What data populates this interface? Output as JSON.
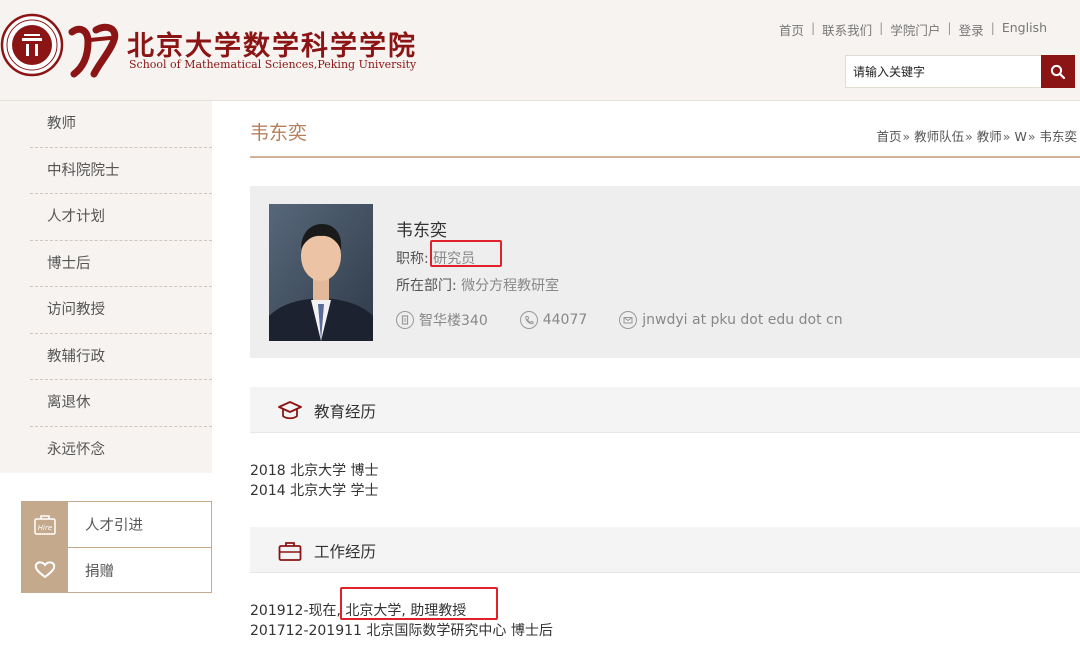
{
  "header": {
    "seal_text": "PEKING UNIVERSITY 1898",
    "brand_cn": "北京大学数学科学学院",
    "brand_en": "School of Mathematical Sciences,Peking University",
    "nav": [
      "首页",
      "联系我们",
      "学院门户",
      "登录",
      "English"
    ],
    "nav_separator": "|",
    "search_placeholder": "请输入关键字",
    "search_icon": "search-icon"
  },
  "sidebar": {
    "items": [
      "教师",
      "中科院院士",
      "人才计划",
      "博士后",
      "访问教授",
      "教辅行政",
      "离退休",
      "永远怀念"
    ],
    "quick_links": [
      {
        "label": "人才引进",
        "icon": "hire-icon",
        "icon_text": "Hire"
      },
      {
        "label": "捐赠",
        "icon": "heart-icon"
      }
    ]
  },
  "page": {
    "title": "韦东奕",
    "breadcrumb": [
      "首页",
      "教师队伍",
      "教师",
      "W",
      "韦东奕"
    ],
    "breadcrumb_separator": "»"
  },
  "profile": {
    "name": "韦东奕",
    "title_label": "职称:",
    "title_value": "研究员",
    "dept_label": "所在部门:",
    "dept_value": "微分方程教研室",
    "office": "智华楼340",
    "phone": "44077",
    "email": "jnwdyi at pku dot edu dot cn"
  },
  "education": {
    "heading": "教育经历",
    "icon": "graduation-cap-icon",
    "lines": [
      "2018 北京大学 博士",
      "2014 北京大学 学士"
    ]
  },
  "work": {
    "heading": "工作经历",
    "icon": "briefcase-icon",
    "lines": [
      "201912-现在, 北京大学, 助理教授",
      "201712-201911 北京国际数学研究中心 博士后"
    ]
  },
  "colors": {
    "brand_red": "#8b1515",
    "accent_tan": "#c5a98d",
    "title_brown": "#b57f5c",
    "highlight_red": "#e0202a"
  }
}
